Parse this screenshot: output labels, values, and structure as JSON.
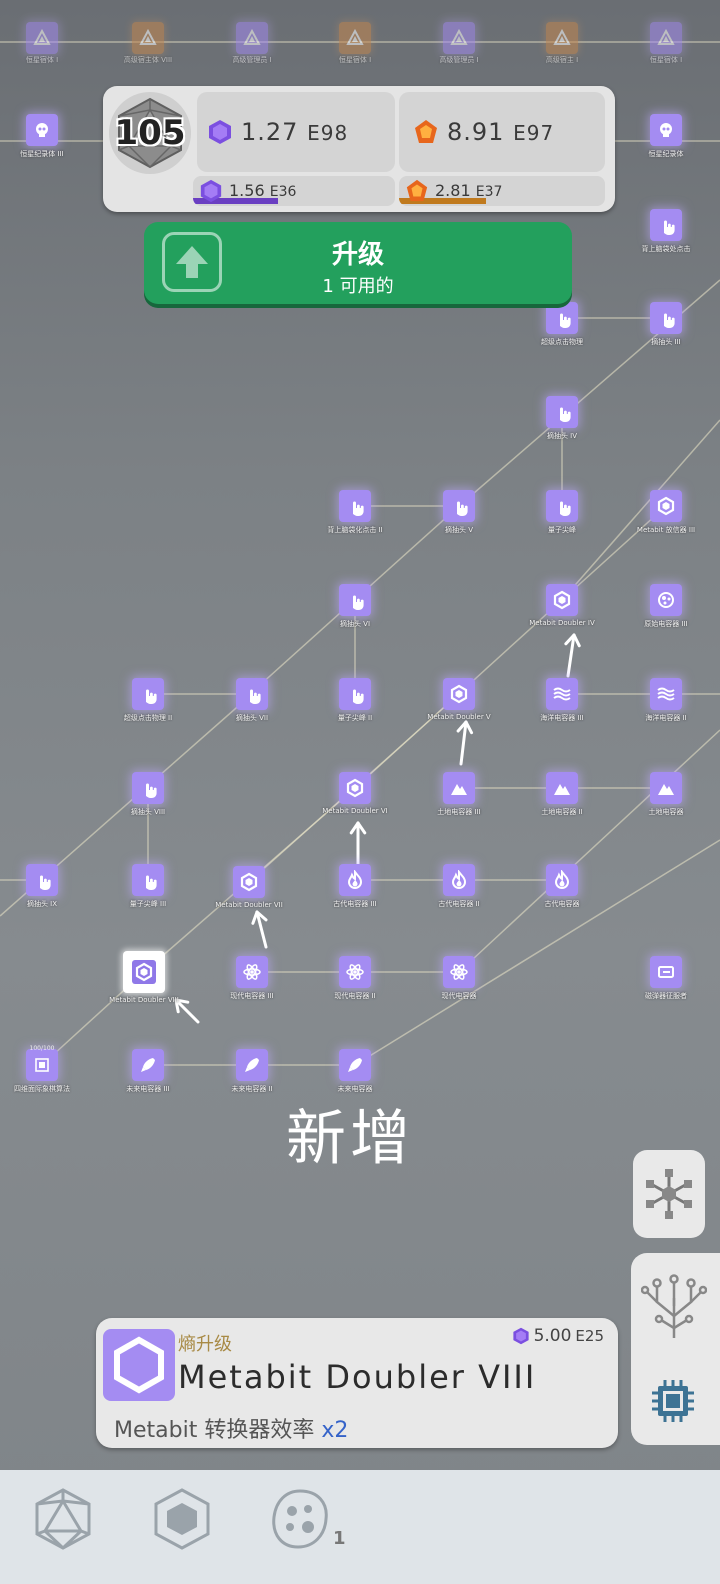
{
  "header": {
    "level": "105",
    "metabits": {
      "mantissa": "1.27",
      "exp": "E98"
    },
    "entropy": {
      "mantissa": "8.91",
      "exp": "E97"
    },
    "metabits_rate": {
      "mantissa": "1.56",
      "exp": "E36",
      "fill": 0.42
    },
    "entropy_rate": {
      "mantissa": "2.81",
      "exp": "E37",
      "fill": 0.42
    }
  },
  "upgrade_button": {
    "title": "升级",
    "subtitle": "1 可用的"
  },
  "tree": {
    "top_row": [
      "恒星宿体 I",
      "高级宿主体 VIII",
      "高级管理员 I",
      "恒星宿体 I",
      "高级管理员 I",
      "高级宿主 I",
      "恒星宿体 I"
    ],
    "nodes": [
      {
        "label": "恒星纪录体 III"
      },
      {
        "label": "恒星纪录体"
      },
      {
        "label": "背上脑袋处点击"
      },
      {
        "label": "超级点击物理"
      },
      {
        "label": "摘抽头 III"
      },
      {
        "label": "摘抽头 IV"
      },
      {
        "label": "背上脑袋化点击 II"
      },
      {
        "label": "摘抽头 V"
      },
      {
        "label": "量子尖峰"
      },
      {
        "label": "Metabit 放信器 III"
      },
      {
        "label": "摘抽头 VI"
      },
      {
        "label": "Metabit Doubler IV"
      },
      {
        "label": "原始电容器 III"
      },
      {
        "label": "超级点击物理 II"
      },
      {
        "label": "摘抽头 VII"
      },
      {
        "label": "量子尖峰 II"
      },
      {
        "label": "Metabit Doubler V"
      },
      {
        "label": "海洋电容器 III"
      },
      {
        "label": "海洋电容器 II"
      },
      {
        "label": "摘抽头 VIII"
      },
      {
        "label": "Metabit Doubler VI"
      },
      {
        "label": "土地电容器 III"
      },
      {
        "label": "土地电容器 II"
      },
      {
        "label": "土地电容器"
      },
      {
        "label": "摘抽头 IX"
      },
      {
        "label": "量子尖峰 III"
      },
      {
        "label": "Metabit Doubler VII"
      },
      {
        "label": "古代电容器 III"
      },
      {
        "label": "古代电容器 II"
      },
      {
        "label": "古代电容器"
      },
      {
        "label": "Metabit Doubler VIII"
      },
      {
        "label": "现代电容器 III"
      },
      {
        "label": "现代电容器 II"
      },
      {
        "label": "现代电容器"
      },
      {
        "label": "磁弹器征服者"
      },
      {
        "label": "四维面际象棋算法",
        "badge": "100/100"
      },
      {
        "label": "未来电容器 III"
      },
      {
        "label": "未来电容器 II"
      },
      {
        "label": "未来电容器"
      }
    ]
  },
  "new_label": "新增",
  "info_card": {
    "category": "熵升级",
    "cost": {
      "mantissa": "5.00",
      "exp": "E25"
    },
    "title": "Metabit Doubler VIII",
    "description": "Metabit 转换器效率 ",
    "multiplier": "x2"
  },
  "bottom_nav": {
    "badge": "1"
  },
  "colors": {
    "node": "#a48cf2",
    "green": "#23a05d",
    "purple_bar": "#6a3fc2",
    "orange_bar": "#c07a1e"
  },
  "icons": [
    "d20-icon",
    "hexagon-icon",
    "cell-icon",
    "network-icon",
    "tree-icon",
    "chip-icon",
    "hand-pointer-icon",
    "fire-icon",
    "mountain-icon",
    "waves-icon",
    "atom-icon",
    "rocket-icon"
  ]
}
